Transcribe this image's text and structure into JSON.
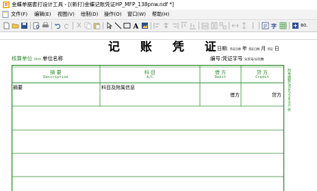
{
  "window": {
    "title": "金蝶单据套打设计工具 - [(新打)金蝶记账凭证HP_MFP_138pnw.ndf *]"
  },
  "menu": {
    "items": [
      "文件(F)",
      "编辑(E)",
      "视图(V)",
      "绘制(D)",
      "操作(O)",
      "窗口(W)",
      "帮助(H)"
    ]
  },
  "toolbar": {
    "zoom": "80."
  },
  "voucher": {
    "title": "记 账 凭 证",
    "date_label": "日期:",
    "date_year": "凭证日期",
    "date_year_suffix": "年",
    "date_month": "凭证日期",
    "date_month_suffix": "月",
    "date_day": "凭证",
    "date_day_suffix": "日",
    "unit_label": "核算单位",
    "unit_label_small": "Unit",
    "unit_value": "单位名称",
    "number_label": "编号:",
    "number_value": "凭证字号",
    "number_small": "分页号/分页数",
    "columns": [
      {
        "cn": "摘  要",
        "en": "Description"
      },
      {
        "cn": "科  目",
        "en": "A/C"
      },
      {
        "cn": "借  方",
        "en": "Debit"
      },
      {
        "cn": "贷  方",
        "en": "Credit"
      }
    ],
    "row1": {
      "summary": "摘要",
      "account": "科目及附属信息",
      "debit": "借方",
      "credit": "贷方"
    },
    "side_text": "附单据数(Attachments)  张"
  },
  "colors": {
    "green_border": "#2a8a2a",
    "menubar_bg": "#f3f3f3",
    "toolbar_bg": "#f0f0f0"
  }
}
